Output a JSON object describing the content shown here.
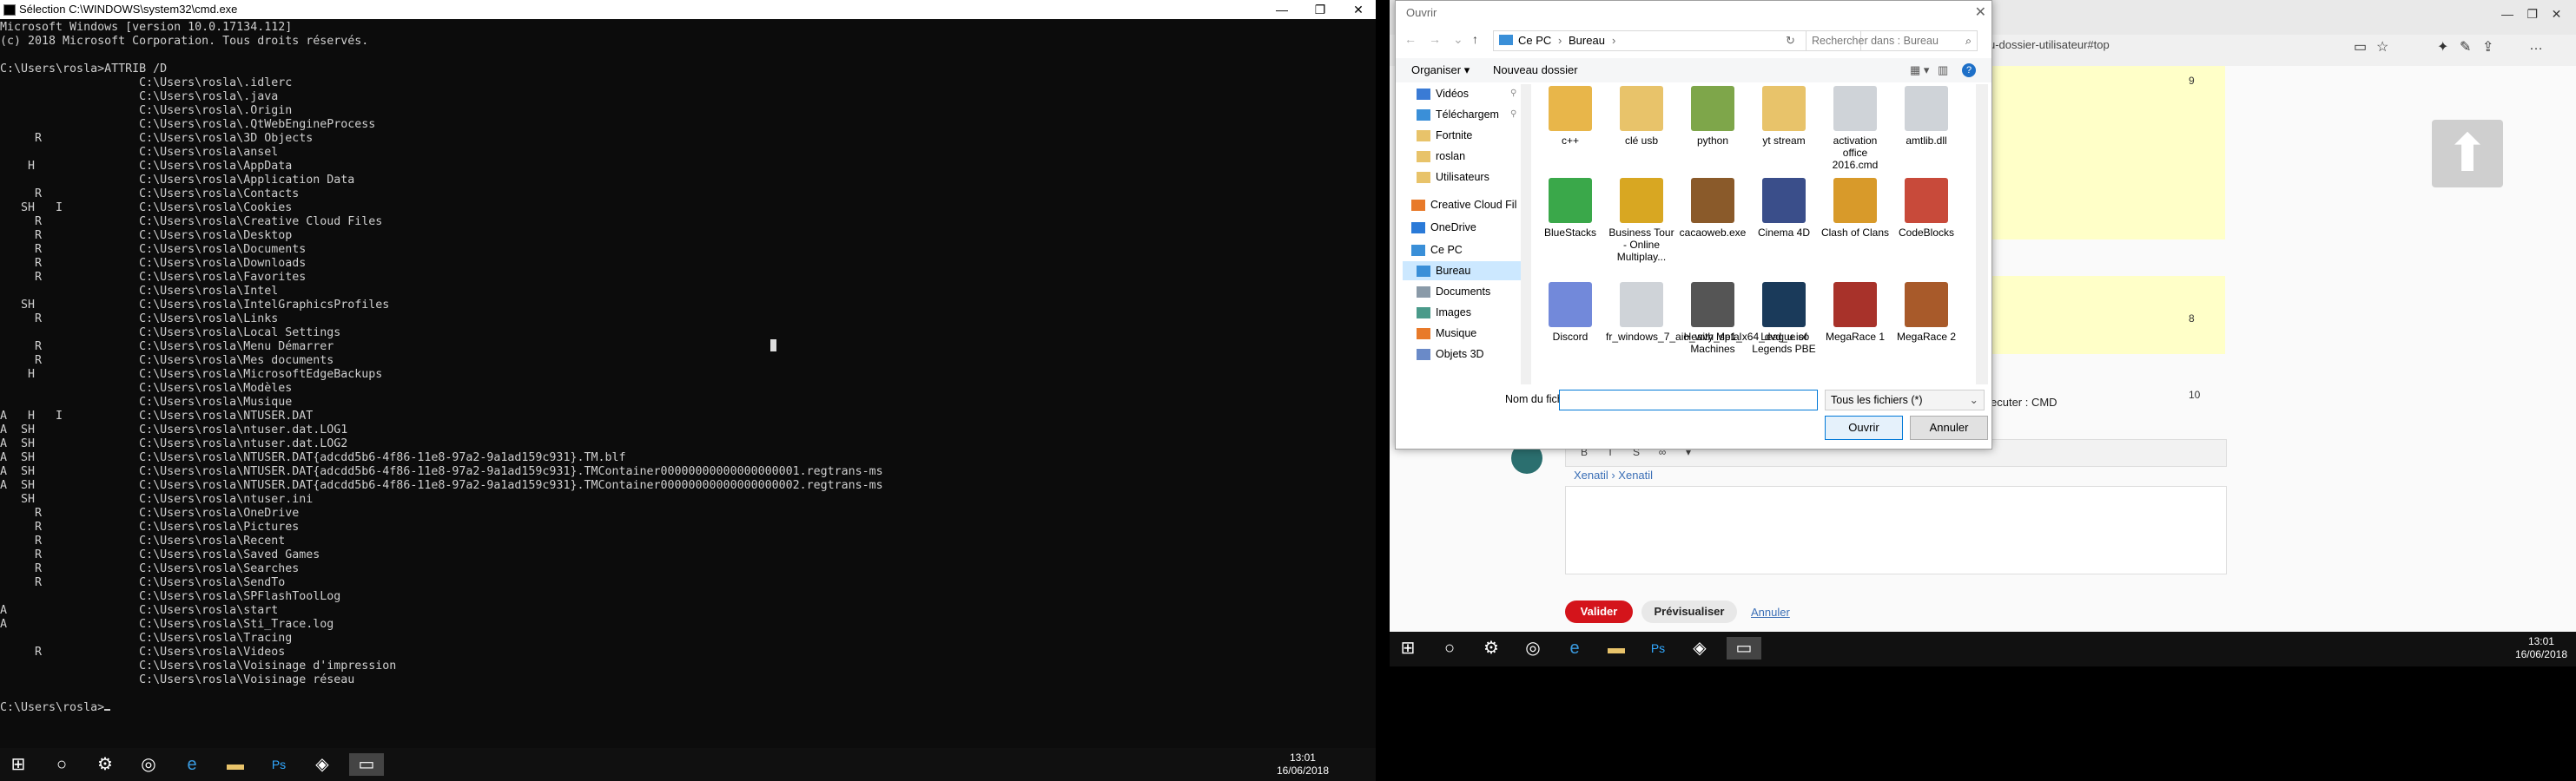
{
  "cmd": {
    "title": "Sélection C:\\WINDOWS\\system32\\cmd.exe",
    "lines": [
      "Microsoft Windows [version 10.0.17134.112]",
      "(c) 2018 Microsoft Corporation. Tous droits réservés.",
      "",
      "C:\\Users\\rosla>ATTRIB /D",
      "                    C:\\Users\\rosla\\.idlerc",
      "                    C:\\Users\\rosla\\.java",
      "                    C:\\Users\\rosla\\.Origin",
      "                    C:\\Users\\rosla\\.QtWebEngineProcess",
      "     R              C:\\Users\\rosla\\3D Objects",
      "                    C:\\Users\\rosla\\ansel",
      "    H               C:\\Users\\rosla\\AppData",
      "                    C:\\Users\\rosla\\Application Data",
      "     R              C:\\Users\\rosla\\Contacts",
      "   SH   I           C:\\Users\\rosla\\Cookies",
      "     R              C:\\Users\\rosla\\Creative Cloud Files",
      "     R              C:\\Users\\rosla\\Desktop",
      "     R              C:\\Users\\rosla\\Documents",
      "     R              C:\\Users\\rosla\\Downloads",
      "     R              C:\\Users\\rosla\\Favorites",
      "                    C:\\Users\\rosla\\Intel",
      "   SH               C:\\Users\\rosla\\IntelGraphicsProfiles",
      "     R              C:\\Users\\rosla\\Links",
      "                    C:\\Users\\rosla\\Local Settings",
      "     R              C:\\Users\\rosla\\Menu Démarrer",
      "     R              C:\\Users\\rosla\\Mes documents",
      "    H               C:\\Users\\rosla\\MicrosoftEdgeBackups",
      "                    C:\\Users\\rosla\\Modèles",
      "                    C:\\Users\\rosla\\Musique",
      "A   H   I           C:\\Users\\rosla\\NTUSER.DAT",
      "A  SH               C:\\Users\\rosla\\ntuser.dat.LOG1",
      "A  SH               C:\\Users\\rosla\\ntuser.dat.LOG2",
      "A  SH               C:\\Users\\rosla\\NTUSER.DAT{adcdd5b6-4f86-11e8-97a2-9a1ad159c931}.TM.blf",
      "A  SH               C:\\Users\\rosla\\NTUSER.DAT{adcdd5b6-4f86-11e8-97a2-9a1ad159c931}.TMContainer00000000000000000001.regtrans-ms",
      "A  SH               C:\\Users\\rosla\\NTUSER.DAT{adcdd5b6-4f86-11e8-97a2-9a1ad159c931}.TMContainer00000000000000000002.regtrans-ms",
      "   SH               C:\\Users\\rosla\\ntuser.ini",
      "     R              C:\\Users\\rosla\\OneDrive",
      "     R              C:\\Users\\rosla\\Pictures",
      "     R              C:\\Users\\rosla\\Recent",
      "     R              C:\\Users\\rosla\\Saved Games",
      "     R              C:\\Users\\rosla\\Searches",
      "     R              C:\\Users\\rosla\\SendTo",
      "                    C:\\Users\\rosla\\SPFlashToolLog",
      "A                   C:\\Users\\rosla\\start",
      "A                   C:\\Users\\rosla\\Sti_Trace.log",
      "                    C:\\Users\\rosla\\Tracing",
      "     R              C:\\Users\\rosla\\Videos",
      "                    C:\\Users\\rosla\\Voisinage d'impression",
      "                    C:\\Users\\rosla\\Voisinage réseau",
      "",
      "C:\\Users\\rosla>"
    ]
  },
  "taskbar_left": {
    "time": "13:01",
    "date": "16/06/2018"
  },
  "taskbar_right": {
    "time": "13:01",
    "date": "16/06/2018"
  },
  "browser": {
    "url_fragment": "u-dossier-utilisateur#top",
    "counts": [
      "9",
      "8",
      "10"
    ],
    "exec_text": "ecuter : CMD",
    "mention": "Xenatil › Xenatil",
    "valider": "Valider",
    "previsualiser": "Prévisualiser",
    "annuler": "Annuler",
    "editor_tools": [
      "B",
      "I",
      "S",
      "∞",
      "▾"
    ]
  },
  "dialog": {
    "title": "Ouvrir",
    "path": [
      "Ce PC",
      "Bureau"
    ],
    "search_placeholder": "Rechercher dans : Bureau",
    "organiser": "Organiser ▾",
    "nouveau_dossier": "Nouveau dossier",
    "nav_items": [
      {
        "label": "Vidéos",
        "pin": true
      },
      {
        "label": "Téléchargem",
        "pin": true
      },
      {
        "label": "Fortnite"
      },
      {
        "label": "roslan"
      },
      {
        "label": "Utilisateurs"
      },
      {
        "label": "Creative Cloud Fil"
      },
      {
        "label": "OneDrive"
      },
      {
        "label": "Ce PC"
      },
      {
        "label": "Bureau"
      },
      {
        "label": "Documents"
      },
      {
        "label": "Images"
      },
      {
        "label": "Musique"
      },
      {
        "label": "Objets 3D"
      }
    ],
    "files": [
      {
        "label": "c++",
        "color": "#e8b64a"
      },
      {
        "label": "clé usb",
        "color": "#e8c36a"
      },
      {
        "label": "python",
        "color": "#7ea64a"
      },
      {
        "label": "yt stream",
        "color": "#e8c36a"
      },
      {
        "label": "activation office 2016.cmd",
        "color": "#cfd3d8"
      },
      {
        "label": "amtlib.dll",
        "color": "#cfd3d8"
      },
      {
        "label": "BlueStacks",
        "color": "#3aa84a"
      },
      {
        "label": "Business Tour - Online Multiplay...",
        "color": "#d8a722"
      },
      {
        "label": "cacaoweb.exe",
        "color": "#8a5a2a"
      },
      {
        "label": "Cinema 4D",
        "color": "#3a4e8a"
      },
      {
        "label": "Clash of Clans",
        "color": "#d89a2a"
      },
      {
        "label": "CodeBlocks",
        "color": "#c84a3a"
      },
      {
        "label": "Discord",
        "color": "#7289da"
      },
      {
        "label": "fr_windows_7_aio_with_sp1_x64_dvd_u.iso",
        "color": "#cfd3d8"
      },
      {
        "label": "Heavy Metal Machines",
        "color": "#555555"
      },
      {
        "label": "League of Legends PBE",
        "color": "#1a3a5a"
      },
      {
        "label": "MegaRace 1",
        "color": "#a8322a"
      },
      {
        "label": "MegaRace 2",
        "color": "#a85a2a"
      }
    ],
    "filename_label": "Nom du fichier :",
    "filename_value": "",
    "filetype": "Tous les fichiers (*)",
    "ouvrir": "Ouvrir",
    "annuler": "Annuler"
  }
}
